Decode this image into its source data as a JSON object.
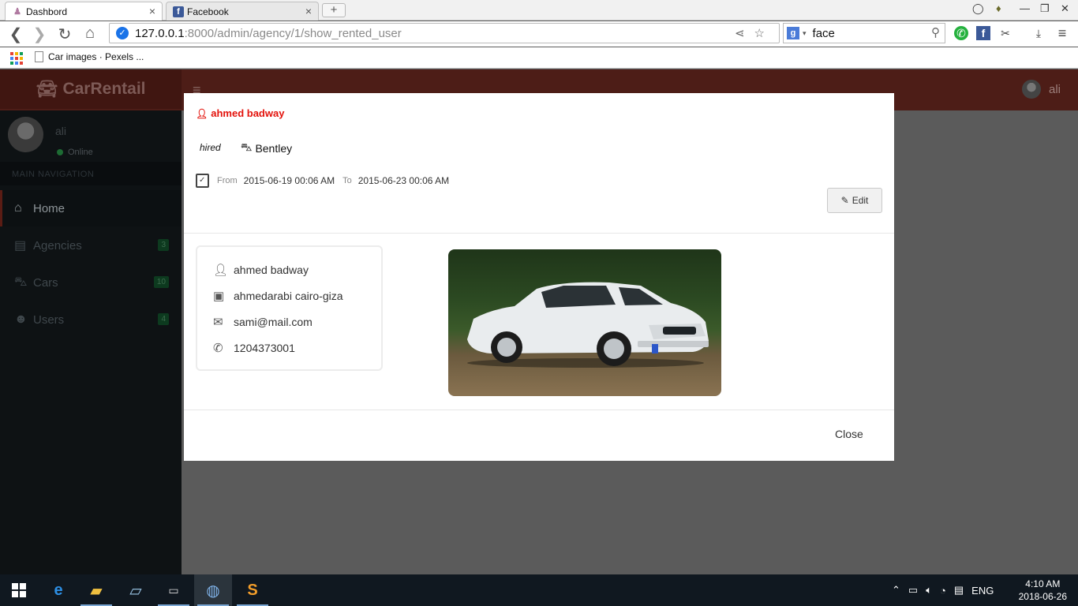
{
  "browser": {
    "tabs": [
      {
        "title": "Dashbord",
        "active": true
      },
      {
        "title": "Facebook",
        "active": false
      }
    ],
    "url_host": "127.0.0.1",
    "url_path": ":8000/admin/agency/1/show_rented_user",
    "search_value": "face",
    "bookmark": "Car images · Pexels ..."
  },
  "app": {
    "brand": "CarRentail",
    "top_user": "ali",
    "sidebar": {
      "user_name": "ali",
      "status": "Online",
      "nav_header": "MAIN NAVIGATION",
      "items": [
        {
          "label": "Home",
          "badge": ""
        },
        {
          "label": "Agencies",
          "badge": "3"
        },
        {
          "label": "Cars",
          "badge": "10"
        },
        {
          "label": "Users",
          "badge": "4"
        }
      ]
    }
  },
  "modal": {
    "renter_name": "ahmed badway",
    "status": "hired",
    "car_name": "Bentley",
    "from_label": "From",
    "from_value": "2015-06-19 00:06 AM",
    "to_label": "To",
    "to_value": "2015-06-23 00:06 AM",
    "edit_label": "Edit",
    "info": {
      "name": "ahmed badway",
      "address": "ahmedarabi cairo-giza",
      "email": "sami@mail.com",
      "phone": "1204373001"
    },
    "close_label": "Close"
  },
  "taskbar": {
    "lang": "ENG",
    "time": "4:10 AM",
    "date": "2018-06-26"
  },
  "colors": {
    "accent_red": "#e3120b",
    "header_bg": "#4d1d17",
    "sidebar_bg": "#0e1214"
  }
}
